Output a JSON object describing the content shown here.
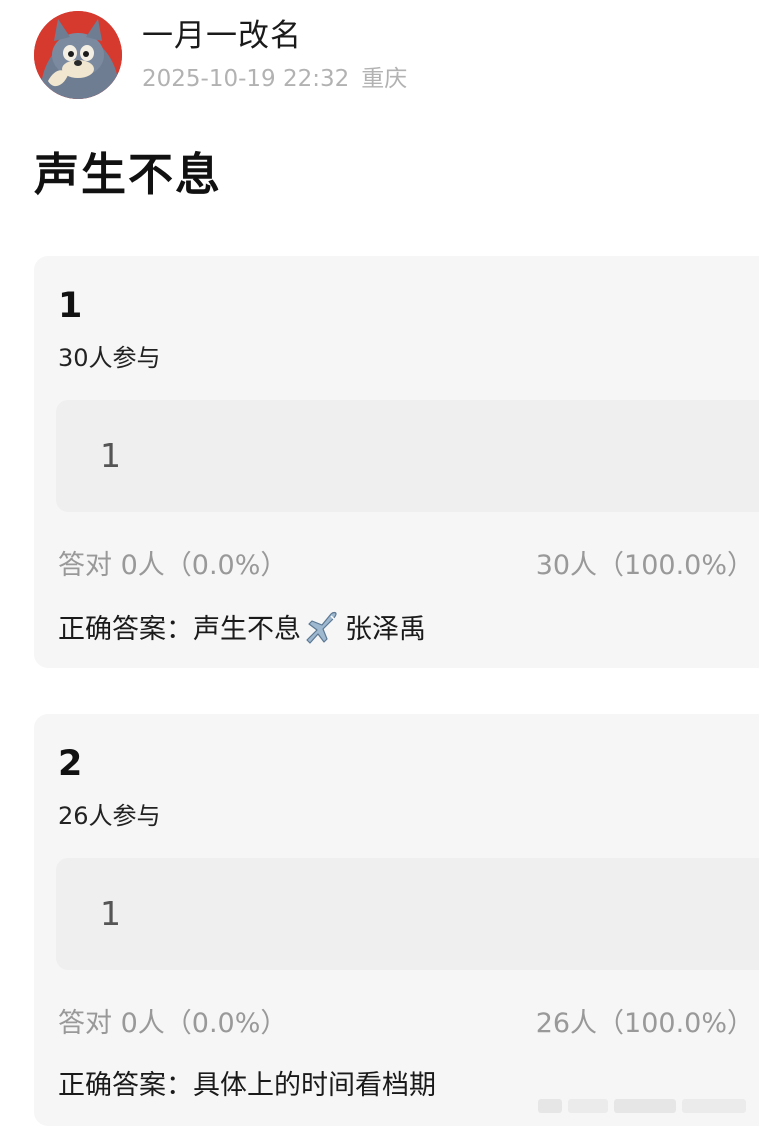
{
  "post": {
    "author": "一月一改名",
    "timestamp": "2025-10-19 22:32",
    "location": "重庆",
    "title": "声生不息"
  },
  "questions": [
    {
      "number": "1",
      "participants": "30人参与",
      "option": "1",
      "correct_stat": "答对  0人（0.0%）",
      "other_stat": "30人（100.0%）",
      "answer_label": "正确答案：",
      "answer_text": "声生不息",
      "answer_suffix": "张泽禹"
    },
    {
      "number": "2",
      "participants": "26人参与",
      "option": "1",
      "correct_stat": "答对  0人（0.0%）",
      "other_stat": "26人（100.0%）",
      "answer_label": "正确答案：",
      "answer_text": "具体上的时间看档期"
    }
  ],
  "icons": {
    "avatar": "cartoon-cat-avatar",
    "answer_emoji": "airplane-icon"
  },
  "colors": {
    "card_bg": "#f6f6f6",
    "option_bg": "#efefef",
    "muted_text": "#999999",
    "meta_text": "#b2b2b2"
  }
}
